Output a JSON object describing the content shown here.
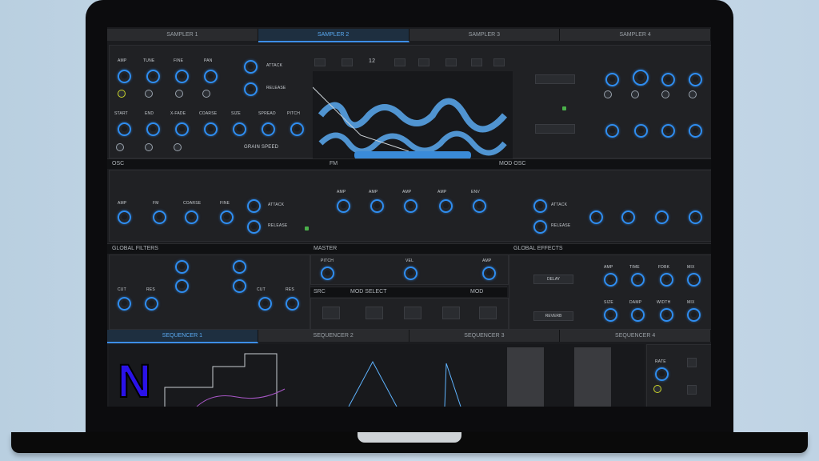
{
  "sampler_tabs": [
    "SAMPLER 1",
    "SAMPLER 2",
    "SAMPLER 3",
    "SAMPLER 4"
  ],
  "sampler_knobs_top": [
    "AMP",
    "TUNE",
    "FINE",
    "PAN"
  ],
  "sampler_knobs_bottom": [
    "START",
    "END",
    "X-FADE",
    "COARSE",
    "SIZE",
    "SPREAD",
    "PITCH"
  ],
  "attack_label": "ATTACK",
  "release_label": "RELEASE",
  "grain_label": "GRAIN SPEED",
  "wave_counter": "12",
  "section_osc": "OSC",
  "section_fm": "FM",
  "section_mod_osc": "MOD OSC",
  "osc_knobs": [
    "AMP",
    "FM",
    "COARSE",
    "FINE"
  ],
  "fm_knobs": [
    "AMP",
    "AMP",
    "AMP",
    "AMP",
    "ENV"
  ],
  "section_filters": "GLOBAL FILTERS",
  "section_master": "MASTER",
  "section_effects": "GLOBAL EFFECTS",
  "master_labels": [
    "PITCH",
    "VEL",
    "AMP"
  ],
  "filter_labels": [
    "CUT",
    "RES",
    "CUT",
    "RES"
  ],
  "effect_knobs": [
    "AMP",
    "TIME",
    "FDBK",
    "MIX",
    "SIZE",
    "DAMP",
    "WIDTH",
    "MIX"
  ],
  "dropdown_delay": "DELAY",
  "dropdown_reverb": "REVERB",
  "src_label": "SRC",
  "mod_select": "MOD SELECT",
  "mod_label": "MOD",
  "sequencer_tabs": [
    "SEQUENCER 1",
    "SEQUENCER 2",
    "SEQUENCER 3",
    "SEQUENCER 4"
  ],
  "seq_knob_label": "RATE",
  "logo_letter": "N",
  "colors": {
    "accent": "#2f8df0",
    "panel": "#202124",
    "bg": "#1b1c1f",
    "logo": "#2a12e8"
  }
}
